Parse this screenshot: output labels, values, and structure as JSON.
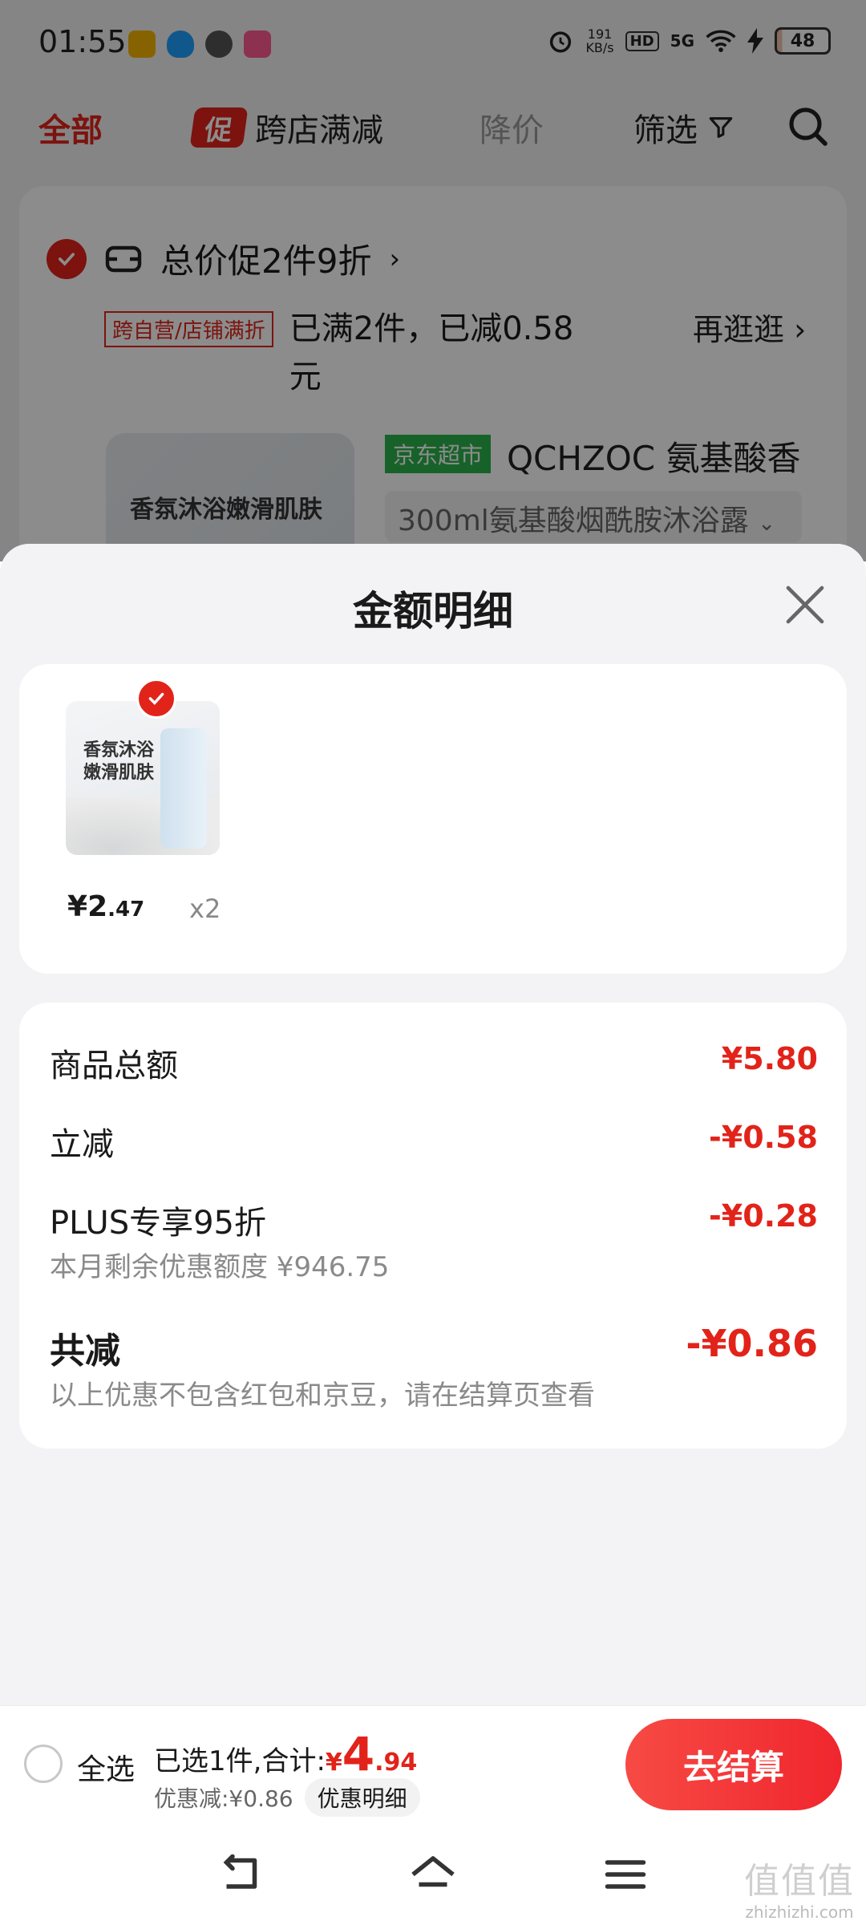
{
  "status_bar": {
    "time": "01:55",
    "net_speed_value": "191",
    "net_speed_unit": "KB/s",
    "hd_label": "HD",
    "network": "5G",
    "battery": "48"
  },
  "tabs": {
    "all": "全部",
    "promo_badge": "促",
    "promo": "跨店满减",
    "price_drop": "降价",
    "filter": "筛选"
  },
  "cart": {
    "promo_title": "总价促2件9折",
    "promo_tag": "跨自营/店铺满折",
    "promo_status": "已满2件，已减0.58元",
    "browse_more": "再逛逛",
    "store_tag": "京东超市",
    "product_title": "QCHZOC 氨基酸香",
    "product_thumb_text": "香氛沐浴嫩滑肌肤",
    "spec": "300ml氨基酸烟酰胺沐浴露"
  },
  "sheet": {
    "title": "金额明细",
    "item": {
      "thumb_text_line1": "香氛沐浴",
      "thumb_text_line2": "嫩滑肌肤",
      "price_currency": "¥",
      "price_int": "2",
      "price_dec": ".47",
      "qty": "x2"
    },
    "rows": {
      "goods_total_label": "商品总额",
      "goods_total_value": "¥5.80",
      "instant_label": "立减",
      "instant_value": "-¥0.58",
      "plus_label": "PLUS专享95折",
      "plus_value": "-¥0.28",
      "plus_sub": "本月剩余优惠额度 ¥946.75",
      "total_label": "共减",
      "total_value": "-¥0.86",
      "total_sub": "以上优惠不包含红包和京豆，请在结算页查看"
    }
  },
  "checkout": {
    "select_all": "全选",
    "summary_prefix": "已选1件,合计:",
    "currency": "¥",
    "total_int": "4",
    "total_dec": ".94",
    "discount": "优惠减:¥0.86",
    "detail_chip": "优惠明细",
    "button": "去结算"
  },
  "watermark": {
    "big": "值值值",
    "small": "zhizhizhi.com"
  },
  "colors": {
    "accent": "#e2231a",
    "jd_green": "#2bb24c",
    "sheet_bg": "#f3f3f5"
  }
}
